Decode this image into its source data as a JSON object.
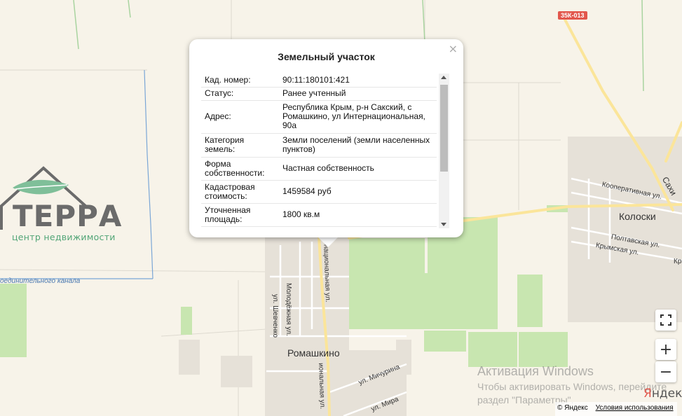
{
  "balloon": {
    "title": "Земельный участок",
    "close": "×",
    "rows": [
      {
        "label": "Кад. номер:",
        "value": "90:11:180101:421"
      },
      {
        "label": "Статус:",
        "value": "Ранее учтенный"
      },
      {
        "label": "Адрес:",
        "value": "Республика Крым, р-н Сакский, с Ромашкино, ул Интернациональная, 90а"
      },
      {
        "label": "Категория земель:",
        "value": "Земли поселений (земли населенных пунктов)"
      },
      {
        "label": "Форма собственности:",
        "value": "Частная собственность"
      },
      {
        "label": "Кадастровая стоимость:",
        "value": "1459584 руб"
      },
      {
        "label": "Уточненная площадь:",
        "value": "1800 кв.м"
      }
    ]
  },
  "logo": {
    "name": "ТЕРРА",
    "tagline": "центр недвижимости"
  },
  "map_labels": {
    "village": "Ромашкино",
    "town": "Колоски",
    "canal": "оединительного канала",
    "street_shevchenko": "ул. Шевченко",
    "street_molodezhnaya": "Молодёжная ул.",
    "street_internatsionalnaya_top": "рнациональная ул.",
    "street_internatsionalnaya_bottom": "иональная ул.",
    "street_michurina": "ул. Мичурина",
    "street_mira": "ул. Мира",
    "street_kooperativnaya": "Кооперативная ул.",
    "street_poltavskaya": "Полтавская ул.",
    "street_krymskaya": "Крымская ул.",
    "street_sakh": "Сахи",
    "street_kr": "Кр",
    "road_number": "35К-013"
  },
  "controls": {
    "fullscreen": "⛶",
    "zoom_in": "+",
    "zoom_out": "−"
  },
  "watermark": {
    "line1": "Активация Windows",
    "line2": "Чтобы активировать Windows, перейдите",
    "line3": "раздел \"Параметры\"."
  },
  "provider": {
    "logo_y": "Я",
    "logo_rest": "ндекс",
    "copyright": "© Яндекс",
    "terms": "Условия использования"
  },
  "colors": {
    "field_green": "#c8e6b0",
    "road_yellow": "#fbe59a",
    "canal_blue": "#7aa6d6",
    "settlement": "#e6e1d8",
    "badge_red": "#e2574c"
  }
}
